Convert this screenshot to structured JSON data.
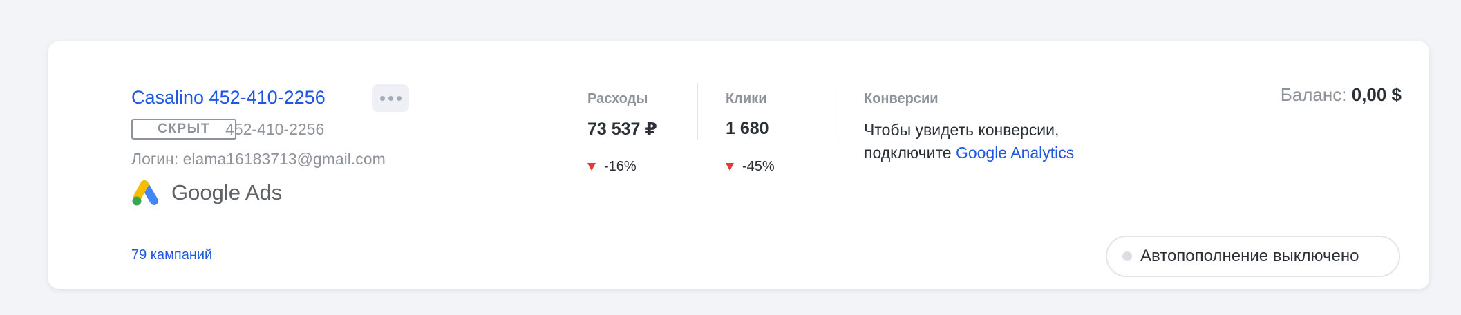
{
  "account": {
    "name": "Casalino 452-410-2256",
    "status": "СКРЫТ",
    "id": "452-410-2256",
    "login": "Логин: elama16183713@gmail.com",
    "platform": "Google Ads",
    "campaigns": "79 кампаний"
  },
  "metrics": {
    "spend": {
      "label": "Расходы",
      "value": "73 537 ₽",
      "change": "-16%"
    },
    "clicks": {
      "label": "Клики",
      "value": "1 680",
      "change": "-45%"
    }
  },
  "conversions": {
    "label": "Конверсии",
    "line1": "Чтобы увидеть конверсии,",
    "line2_prefix": "подключите",
    "link": "Google Analytics"
  },
  "balance": {
    "label": "Баланс:",
    "value": "0,00 $"
  },
  "autopay": {
    "label": "Автопополнение выключено"
  },
  "icons": {
    "more": "more-horizontal-icon",
    "trend_down": "triangle-down-icon",
    "brand_logo": "google-ads-logo-icon"
  },
  "colors": {
    "link": "#1f57e0",
    "negative": "#e53935",
    "muted": "#8e929a",
    "background": "#f3f4f7"
  }
}
